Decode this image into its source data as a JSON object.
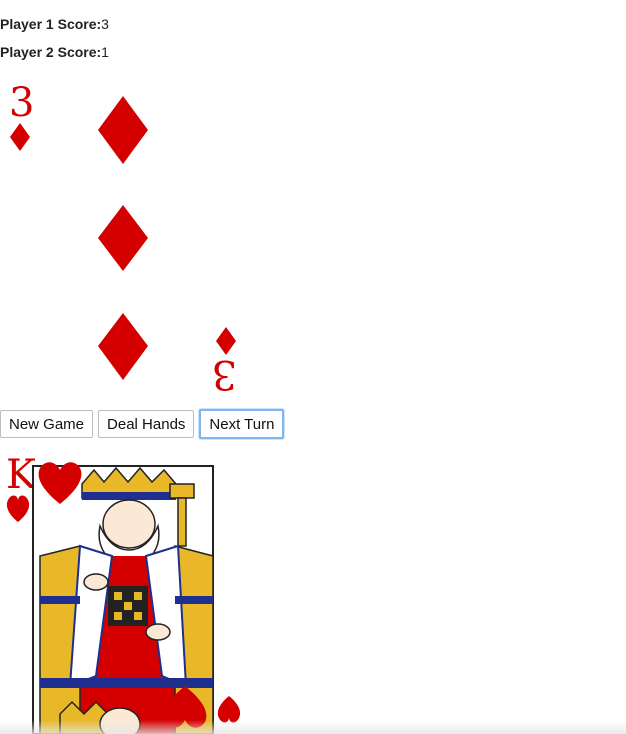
{
  "scores": {
    "player1_label": "Player 1 Score:",
    "player1_value": "3",
    "player2_label": "Player 2 Score:",
    "player2_value": "1"
  },
  "cards": {
    "top": {
      "rank": "3",
      "suit": "diamonds",
      "color": "#d40000"
    },
    "bottom": {
      "rank": "K",
      "suit": "hearts",
      "color": "#d40000"
    }
  },
  "controls": {
    "new_game": "New Game",
    "deal_hands": "Deal Hands",
    "next_turn": "Next Turn"
  },
  "colors": {
    "card_red": "#d40000",
    "king_gold": "#e8b829",
    "king_blue": "#1f2f8f"
  }
}
